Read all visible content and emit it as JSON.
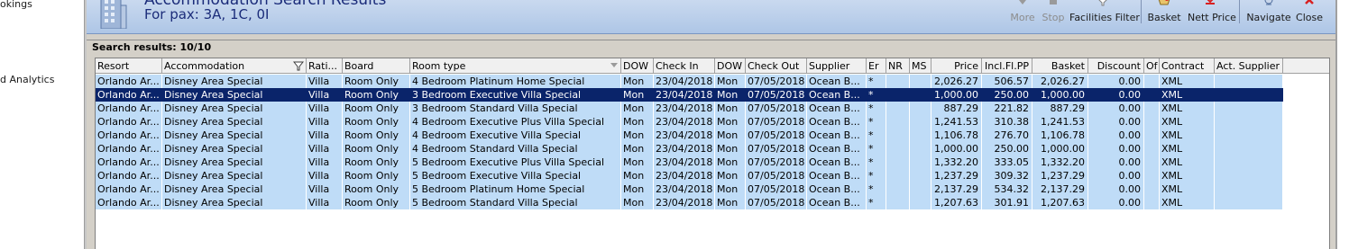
{
  "left_nav": {
    "items": [
      "okings",
      "d Analytics"
    ]
  },
  "window": {
    "title": "Accommodation Search Results",
    "pax_line": "For pax: 3A, 1C, 0I"
  },
  "toolbar": {
    "buttons": [
      {
        "label": "More",
        "icon": "down-arrow-icon",
        "enabled": false
      },
      {
        "label": "Stop",
        "icon": "stop-icon",
        "enabled": false
      },
      {
        "label": "Facilities Filter",
        "icon": "filter-icon",
        "enabled": true
      },
      {
        "label": "Basket",
        "icon": "basket-icon",
        "enabled": true
      },
      {
        "label": "Nett Price",
        "icon": "price-icon",
        "enabled": true
      },
      {
        "label": "Navigate",
        "icon": "navigate-icon",
        "enabled": true
      },
      {
        "label": "Close",
        "icon": "close-icon",
        "enabled": true
      }
    ]
  },
  "results": {
    "summary": "Search results: 10/10",
    "columns": [
      "Resort",
      "Accommodation",
      "Rati...",
      "Board",
      "Room type",
      "DOW",
      "Check In",
      "DOW",
      "Check Out",
      "Supplier",
      "Er",
      "NR",
      "MS",
      "Price",
      "Incl.Fl.PP",
      "Basket",
      "Discount",
      "Of",
      "Contract",
      "Act. Supplier"
    ],
    "selected_row": 1,
    "rows": [
      [
        "Orlando Ar...",
        "Disney Area Special",
        "Villa",
        "Room Only",
        " 4 Bedroom Platinum Home Special",
        "Mon",
        "23/04/2018",
        "Mon",
        "07/05/2018",
        "Ocean B...",
        "*",
        "",
        "",
        "2,026.27",
        "506.57",
        "2,026.27",
        "0.00",
        "",
        "XML",
        ""
      ],
      [
        "Orlando Ar...",
        "Disney Area Special",
        "Villa",
        "Room Only",
        "3 Bedroom Executive Villa Special",
        "Mon",
        "23/04/2018",
        "Mon",
        "07/05/2018",
        "Ocean B...",
        "*",
        "",
        "",
        "1,000.00",
        "250.00",
        "1,000.00",
        "0.00",
        "",
        "XML",
        ""
      ],
      [
        "Orlando Ar...",
        "Disney Area Special",
        "Villa",
        "Room Only",
        "3 Bedroom Standard Villa Special",
        "Mon",
        "23/04/2018",
        "Mon",
        "07/05/2018",
        "Ocean B...",
        "*",
        "",
        "",
        "887.29",
        "221.82",
        "887.29",
        "0.00",
        "",
        "XML",
        ""
      ],
      [
        "Orlando Ar...",
        "Disney Area Special",
        "Villa",
        "Room Only",
        "4 Bedroom Executive Plus Villa Special",
        "Mon",
        "23/04/2018",
        "Mon",
        "07/05/2018",
        "Ocean B...",
        "*",
        "",
        "",
        "1,241.53",
        "310.38",
        "1,241.53",
        "0.00",
        "",
        "XML",
        ""
      ],
      [
        "Orlando Ar...",
        "Disney Area Special",
        "Villa",
        "Room Only",
        "4 Bedroom Executive Villa Special",
        "Mon",
        "23/04/2018",
        "Mon",
        "07/05/2018",
        "Ocean B...",
        "*",
        "",
        "",
        "1,106.78",
        "276.70",
        "1,106.78",
        "0.00",
        "",
        "XML",
        ""
      ],
      [
        "Orlando Ar...",
        "Disney Area Special",
        "Villa",
        "Room Only",
        "4 Bedroom Standard Villa Special",
        "Mon",
        "23/04/2018",
        "Mon",
        "07/05/2018",
        "Ocean B...",
        "*",
        "",
        "",
        "1,000.00",
        "250.00",
        "1,000.00",
        "0.00",
        "",
        "XML",
        ""
      ],
      [
        "Orlando Ar...",
        "Disney Area Special",
        "Villa",
        "Room Only",
        "5 Bedroom Executive Plus Villa Special",
        "Mon",
        "23/04/2018",
        "Mon",
        "07/05/2018",
        "Ocean B...",
        "*",
        "",
        "",
        "1,332.20",
        "333.05",
        "1,332.20",
        "0.00",
        "",
        "XML",
        ""
      ],
      [
        "Orlando Ar...",
        "Disney Area Special",
        "Villa",
        "Room Only",
        "5 Bedroom Executive Villa Special",
        "Mon",
        "23/04/2018",
        "Mon",
        "07/05/2018",
        "Ocean B...",
        "*",
        "",
        "",
        "1,237.29",
        "309.32",
        "1,237.29",
        "0.00",
        "",
        "XML",
        ""
      ],
      [
        "Orlando Ar...",
        "Disney Area Special",
        "Villa",
        "Room Only",
        "5 Bedroom Platinum Home Special",
        "Mon",
        "23/04/2018",
        "Mon",
        "07/05/2018",
        "Ocean B...",
        "*",
        "",
        "",
        "2,137.29",
        "534.32",
        "2,137.29",
        "0.00",
        "",
        "XML",
        ""
      ],
      [
        "Orlando Ar...",
        "Disney Area Special",
        "Villa",
        "Room Only",
        "5 Bedroom Standard Villa Special",
        "Mon",
        "23/04/2018",
        "Mon",
        "07/05/2018",
        "Ocean B...",
        "*",
        "",
        "",
        "1,207.63",
        "301.91",
        "1,207.63",
        "0.00",
        "",
        "XML",
        ""
      ]
    ]
  },
  "colors": {
    "row_bg": "#bfdcf7",
    "selected_bg": "#0a246a",
    "title_text": "#1b2c7a",
    "close_icon": "#d92020"
  }
}
